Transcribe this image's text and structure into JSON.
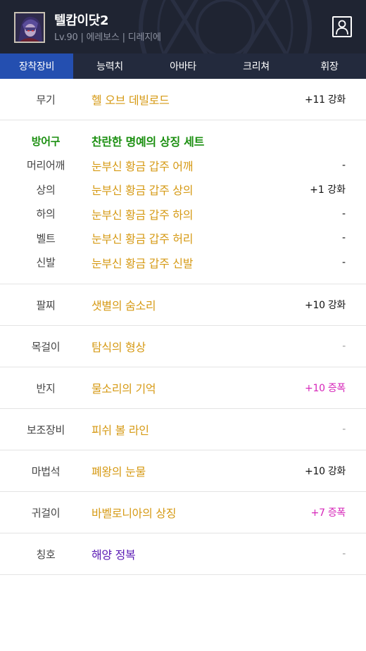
{
  "header": {
    "char_name": "텔캄이닷2",
    "meta": "Lv.90 | 에레보스 | 디레지에",
    "avatar": "character-portrait",
    "profile_icon": "person-badge-icon"
  },
  "tabs": [
    {
      "label": "장착장비",
      "active": true
    },
    {
      "label": "능력치"
    },
    {
      "label": "아바타"
    },
    {
      "label": "크리쳐"
    },
    {
      "label": "휘장"
    }
  ],
  "weapon": {
    "label": "무기",
    "item": "헬 오브 데빌로드",
    "value": "+11 강화"
  },
  "armor": {
    "set_label": "방어구",
    "set_name": "찬란한 명예의 상징 세트",
    "pieces": [
      {
        "label": "머리어깨",
        "item": "눈부신 황금 갑주 어깨",
        "value": "-"
      },
      {
        "label": "상의",
        "item": "눈부신 황금 갑주 상의",
        "value": "+1 강화"
      },
      {
        "label": "하의",
        "item": "눈부신 황금 갑주 하의",
        "value": "-"
      },
      {
        "label": "벨트",
        "item": "눈부신 황금 갑주 허리",
        "value": "-"
      },
      {
        "label": "신발",
        "item": "눈부신 황금 갑주 신발",
        "value": "-"
      }
    ]
  },
  "accessories": [
    {
      "label": "팔찌",
      "item": "샛별의 숨소리",
      "value": "+10 강화",
      "style": "normal"
    },
    {
      "label": "목걸이",
      "item": "탐식의 형상",
      "value": "-",
      "style": "dash"
    },
    {
      "label": "반지",
      "item": "물소리의 기억",
      "value": "+10 증폭",
      "style": "magenta"
    },
    {
      "label": "보조장비",
      "item": "피쉬 볼 라인",
      "value": "-",
      "style": "dash"
    },
    {
      "label": "마법석",
      "item": "폐왕의 눈물",
      "value": "+10 강화",
      "style": "normal"
    },
    {
      "label": "귀걸이",
      "item": "바벨로니아의 상징",
      "value": "+7 증폭",
      "style": "magenta"
    },
    {
      "label": "칭호",
      "item": "해양 정복",
      "value": "-",
      "style": "dash"
    }
  ],
  "colors": {
    "header_bg": "#1f2432",
    "tab_active": "#244fb0",
    "item_gold": "#d69a15",
    "set_green": "#1b8f10",
    "amplify_magenta": "#d626b9",
    "title_purple": "#5a1ab4"
  }
}
